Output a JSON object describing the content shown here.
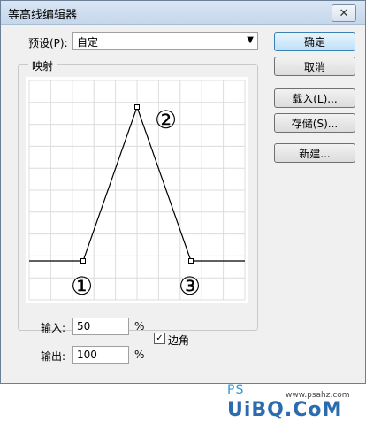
{
  "window": {
    "title": "等高线编辑器",
    "close_glyph": "✕"
  },
  "preset": {
    "label": "预设(P):",
    "value": "自定"
  },
  "mapping": {
    "group_label": "映射"
  },
  "buttons": {
    "ok": "确定",
    "cancel": "取消",
    "load": "载入(L)...",
    "save": "存储(S)...",
    "new": "新建..."
  },
  "curve": {
    "annotations": [
      "①",
      "②",
      "③"
    ],
    "points": [
      [
        0,
        0
      ],
      [
        25,
        0
      ],
      [
        50,
        100
      ],
      [
        75,
        0
      ],
      [
        100,
        0
      ]
    ],
    "grid_divisions": 10
  },
  "input": {
    "label": "输入:",
    "value": "50",
    "unit": "%"
  },
  "output": {
    "label": "输出:",
    "value": "100",
    "unit": "%"
  },
  "corner": {
    "label": "边角",
    "checked": true,
    "check_glyph": "✓"
  },
  "watermark": {
    "ps": "PS",
    "text": "UiBQ.CoM",
    "url": "www.psahz.com"
  }
}
